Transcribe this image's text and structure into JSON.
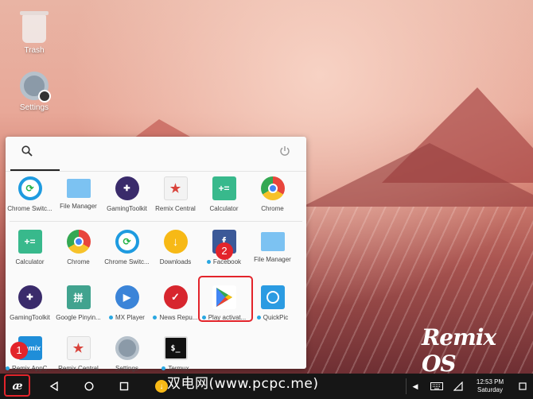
{
  "desktop": {
    "icons": [
      {
        "label": "Trash"
      },
      {
        "label": "Settings"
      }
    ],
    "brand_logo": "Remix OS"
  },
  "launcher": {
    "rows": [
      [
        {
          "label": "Chrome Switc...",
          "icon": "chrome-switch-icon",
          "color": "#1e9be0"
        },
        {
          "label": "File Manager",
          "icon": "folder-icon",
          "color": "#7cc2f2"
        },
        {
          "label": "GamingToolkit",
          "icon": "gamepad-icon",
          "color": "#3a2b6b"
        },
        {
          "label": "Remix Central",
          "icon": "remix-central-icon",
          "color": "#f3f3f3"
        },
        {
          "label": "Calculator",
          "icon": "calculator-icon",
          "color": "#38b98c"
        },
        {
          "label": "Chrome",
          "icon": "chrome-icon",
          "color": "#e8453c"
        }
      ],
      [
        {
          "label": "Calculator",
          "icon": "calculator-icon",
          "color": "#38b98c"
        },
        {
          "label": "Chrome",
          "icon": "chrome-icon",
          "color": "#e8453c"
        },
        {
          "label": "Chrome Switc...",
          "icon": "chrome-switch-icon",
          "color": "#1e9be0"
        },
        {
          "label": "Downloads",
          "icon": "download-icon",
          "color": "#f7b916"
        },
        {
          "label": "Facebook",
          "icon": "facebook-icon",
          "color": "#3b5998",
          "new": true
        },
        {
          "label": "File Manager",
          "icon": "folder-icon",
          "color": "#7cc2f2"
        }
      ],
      [
        {
          "label": "GamingToolkit",
          "icon": "gamepad-icon",
          "color": "#3a2b6b"
        },
        {
          "label": "Google Pinyin...",
          "icon": "pinyin-icon",
          "color": "#41a38f"
        },
        {
          "label": "MX Player",
          "icon": "play-icon",
          "color": "#3b84d8",
          "new": true
        },
        {
          "label": "News Repu...",
          "icon": "news-icon",
          "color": "#d7262e",
          "new": true
        },
        {
          "label": "Play activat...",
          "icon": "google-play-icon",
          "color": "#ffffff",
          "new": true
        },
        {
          "label": "QuickPic",
          "icon": "quickpic-icon",
          "color": "#2b9be2",
          "new": true
        }
      ],
      [
        {
          "label": "Remix AppClo...",
          "icon": "remix-appcloud-icon",
          "color": "#1f8ed9",
          "new": true
        },
        {
          "label": "Remix Central",
          "icon": "remix-central-icon",
          "color": "#f3f3f3"
        },
        {
          "label": "Settings",
          "icon": "gear-icon",
          "color": "#8b9aa8"
        },
        {
          "label": "Termux",
          "icon": "terminal-icon",
          "color": "#111111",
          "new": true
        }
      ]
    ]
  },
  "annotations": {
    "step_1": "1",
    "step_2": "2"
  },
  "taskbar": {
    "watermark": "双电网(www.pcpc.me)",
    "clock_time": "12:53 PM",
    "clock_day": "Saturday"
  },
  "colors": {
    "highlight_red": "#e3242b",
    "taskbar_bg": "#161616",
    "new_dot": "#29a7e1"
  }
}
